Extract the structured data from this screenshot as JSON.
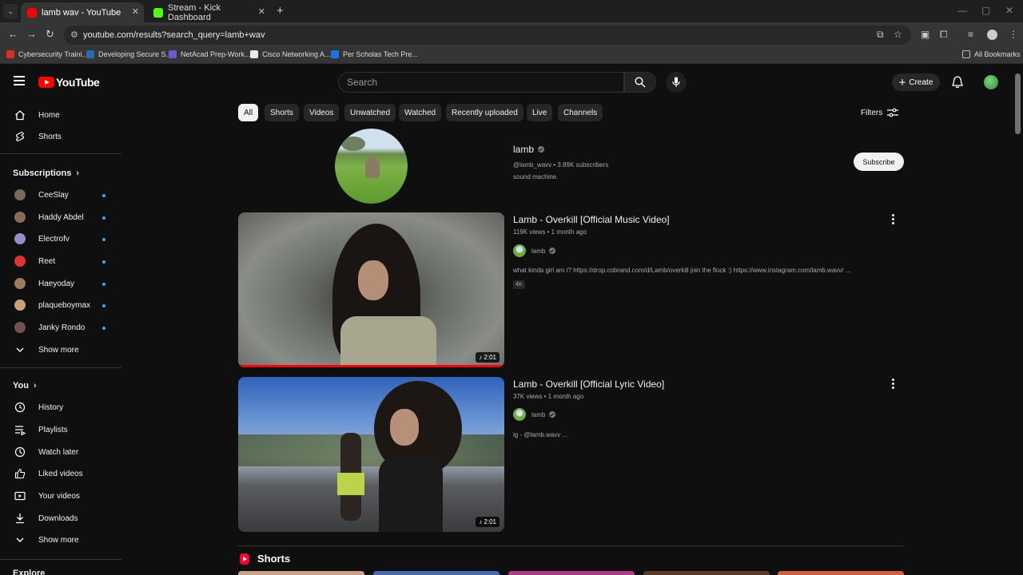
{
  "browser": {
    "tabs": [
      {
        "title": "lamb wav - YouTube",
        "active": true,
        "favicon_color": "#ff0000"
      },
      {
        "title": "Stream - Kick Dashboard",
        "active": false,
        "favicon_color": "#53fc18"
      }
    ],
    "url": "youtube.com/results?search_query=lamb+wav",
    "bookmarks": [
      {
        "label": "Cybersecurity Traini...",
        "color": "#d93025"
      },
      {
        "label": "Developing Secure S...",
        "color": "#2b6cb0"
      },
      {
        "label": "NetAcad Prep-Work...",
        "color": "#6a5acd"
      },
      {
        "label": "Cisco Networking A...",
        "color": "#e8e8e8"
      },
      {
        "label": "Per Scholas Tech Pre...",
        "color": "#1a73e8"
      }
    ],
    "all_bookmarks": "All Bookmarks"
  },
  "header": {
    "logo": "YouTube",
    "search_placeholder": "Search",
    "create_label": "Create"
  },
  "sidebar": {
    "main": [
      {
        "label": "Home",
        "icon": "home-icon"
      },
      {
        "label": "Shorts",
        "icon": "shorts-icon"
      }
    ],
    "subscriptions_label": "Subscriptions",
    "subscriptions": [
      {
        "label": "CeeSlay",
        "color": "#7a6a5a"
      },
      {
        "label": "Haddy Abdel",
        "color": "#8a6a58"
      },
      {
        "label": "Electrofv",
        "color": "#9a8ac8"
      },
      {
        "label": "Reet",
        "color": "#d33"
      },
      {
        "label": "Haeyoday",
        "color": "#a0785a"
      },
      {
        "label": "plaqueboymax",
        "color": "#c9a27a"
      },
      {
        "label": "Janky Rondo",
        "color": "#705050"
      }
    ],
    "show_more": "Show more",
    "you_label": "You",
    "you_items": [
      {
        "label": "History",
        "icon": "history-icon"
      },
      {
        "label": "Playlists",
        "icon": "playlists-icon"
      },
      {
        "label": "Watch later",
        "icon": "watch-later-icon"
      },
      {
        "label": "Liked videos",
        "icon": "like-icon"
      },
      {
        "label": "Your videos",
        "icon": "your-videos-icon"
      },
      {
        "label": "Downloads",
        "icon": "download-icon"
      }
    ],
    "show_more_2": "Show more",
    "explore_label": "Explore"
  },
  "chips": [
    "All",
    "Shorts",
    "Videos",
    "Unwatched",
    "Watched",
    "Recently uploaded",
    "Live",
    "Channels"
  ],
  "filters_label": "Filters",
  "channel": {
    "name": "lamb",
    "meta": "@lamb_wavv • 3.89K subscribers",
    "description": "sound machine.",
    "subscribe_label": "Subscribe"
  },
  "videos": [
    {
      "title": "Lamb - Overkill [Official Music Video]",
      "meta": "119K views • 1 month ago",
      "channel": "lamb",
      "description": "what kinda girl am i? https://drop.cobrand.com/d/Lamb/overkill join the flock :) https://www.instagram.com/lamb.wavv/ ...",
      "badge": "4K",
      "duration": "2:01",
      "watched_fraction": 1.0
    },
    {
      "title": "Lamb - Overkill [Official Lyric Video]",
      "meta": "37K views • 1 month ago",
      "channel": "lamb",
      "description": "ig - @lamb.wavv ...",
      "duration": "2:01"
    }
  ],
  "shorts_heading": "Shorts"
}
